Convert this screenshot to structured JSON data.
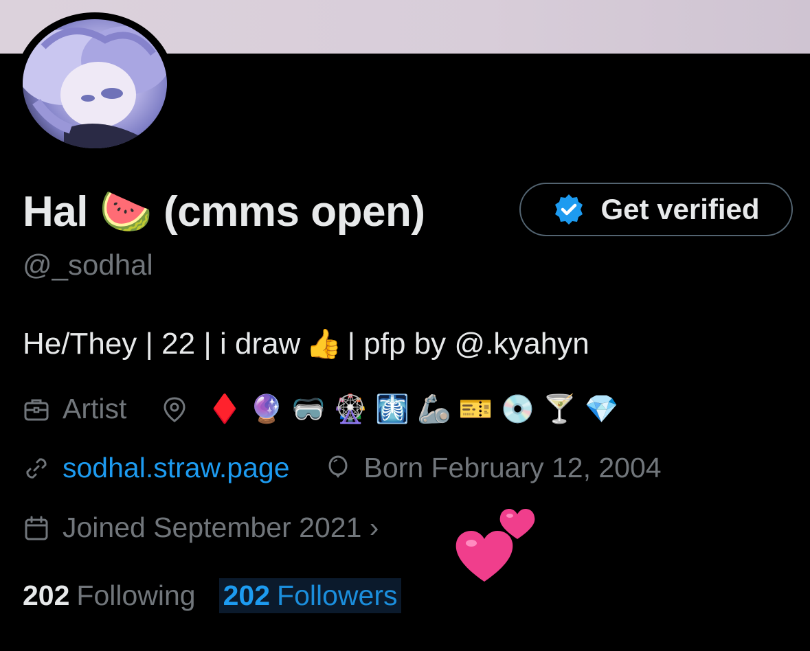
{
  "profile": {
    "display_name": "Hal 🍉 (cmms open)",
    "handle": "@_sodhal",
    "verify_button": "Get verified",
    "bio": {
      "part1": "He/They | 22 | i draw",
      "emoji": "👍",
      "part2": "| pfp by @.kyahyn"
    },
    "category": "Artist",
    "location_emojis": "♦️ 🔮 🥽 🎡 🩻 🦾 🎫 💿 🍸 💎",
    "website": "sodhal.straw.page",
    "birthday": "Born February 12, 2004",
    "joined": "Joined September 2021 ›",
    "following_count": "202",
    "following_label": "Following",
    "followers_count": "202",
    "followers_label": "Followers",
    "decoration_emoji": "💕"
  },
  "colors": {
    "background": "#000000",
    "text": "#e7e9ea",
    "muted": "#71767b",
    "link": "#1d9bf0",
    "banner": "#d9cfda"
  },
  "icons": [
    "briefcase-icon",
    "location-pin-icon",
    "link-icon",
    "balloon-icon",
    "calendar-icon",
    "verified-badge-icon"
  ]
}
